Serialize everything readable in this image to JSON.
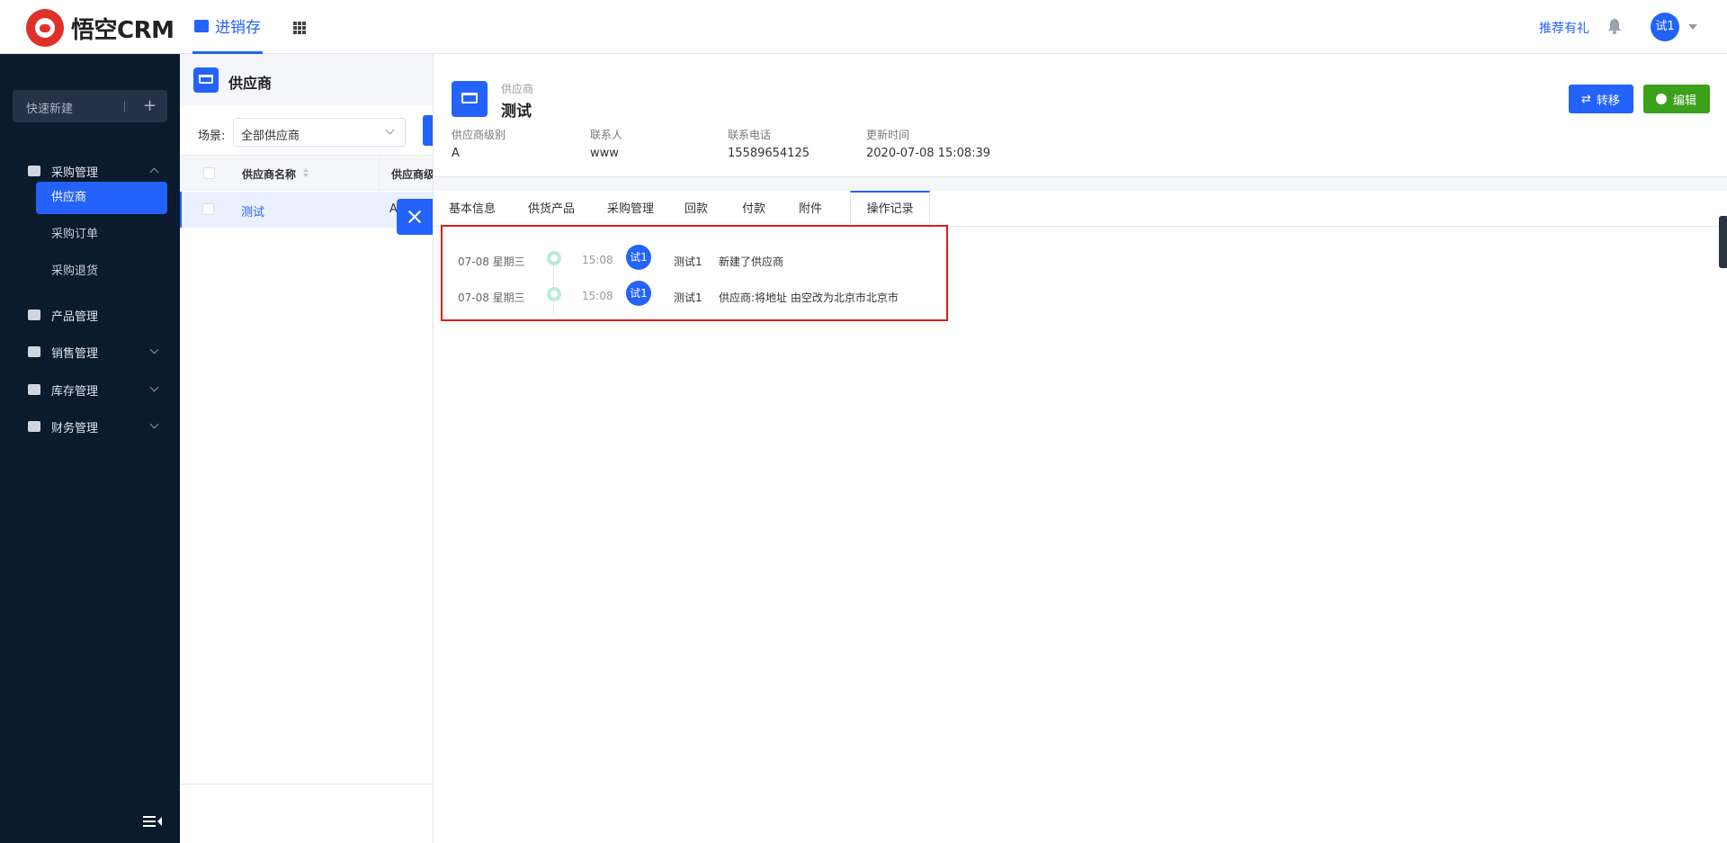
{
  "app": {
    "logo_text": "悟空CRM",
    "module": "进销存",
    "brand_color": "#2362fb"
  },
  "header": {
    "recommend": "推荐有礼",
    "user_initial": "试1"
  },
  "sidebar": {
    "quick_new": "快速新建",
    "menus": [
      {
        "label": "采购管理",
        "icon": "cart-icon",
        "expanded": true
      },
      {
        "label": "产品管理",
        "icon": "box-icon"
      },
      {
        "label": "销售管理",
        "icon": "tag-icon"
      },
      {
        "label": "库存管理",
        "icon": "archive-icon"
      },
      {
        "label": "财务管理",
        "icon": "wallet-icon"
      }
    ],
    "purchase_sub": [
      "供应商",
      "采购订单",
      "采购退货"
    ]
  },
  "list": {
    "title": "供应商",
    "scene_label": "场景:",
    "scene_value": "全部供应商",
    "columns": [
      "供应商名称",
      "供应商级"
    ],
    "rows": [
      {
        "name": "测试",
        "level": "A"
      }
    ]
  },
  "detail": {
    "type_label": "供应商",
    "name": "测试",
    "buttons": {
      "transfer": "转移",
      "edit": "编辑"
    },
    "fields": [
      {
        "label": "供应商级别",
        "value": "A"
      },
      {
        "label": "联系人",
        "value": "www"
      },
      {
        "label": "联系电话",
        "value": "15589654125"
      },
      {
        "label": "更新时间",
        "value": "2020-07-08 15:08:39"
      }
    ],
    "tabs": [
      "基本信息",
      "供货产品",
      "采购管理",
      "回款",
      "付款",
      "附件",
      "操作记录"
    ],
    "active_tab": "操作记录",
    "logs": [
      {
        "date": "07-08 星期三",
        "time": "15:08",
        "avatar": "试1",
        "user": "测试1",
        "content": "新建了供应商"
      },
      {
        "date": "07-08 星期三",
        "time": "15:08",
        "avatar": "试1",
        "user": "测试1",
        "content": "供应商:将地址 由空改为北京市北京市"
      }
    ]
  }
}
